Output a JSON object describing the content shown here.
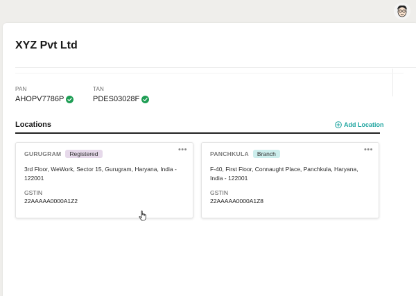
{
  "company": {
    "name": "XYZ Pvt Ltd",
    "pan_label": "PAN",
    "pan_value": "AHOPV7786P",
    "tan_label": "TAN",
    "tan_value": "PDES03028F"
  },
  "locations": {
    "title": "Locations",
    "add_label": "Add Location",
    "accent_color": "#1fa5a0",
    "cards": [
      {
        "city": "GURUGRAM",
        "badge": "Registered",
        "address": "3rd Floor, WeWork, Sector 15, Gurugram, Haryana, India - 122001",
        "gstin_label": "GSTIN",
        "gstin_value": "22AAAAA0000A1Z2"
      },
      {
        "city": "PANCHKULA",
        "badge": "Branch",
        "address": "F-40, First Floor, Connaught Place, Panchkula, Haryana, India - 122001",
        "gstin_label": "GSTIN",
        "gstin_value": "22AAAAA0000A1Z8"
      }
    ]
  },
  "icons": {
    "verified": "check-circle-icon",
    "add": "plus-circle-icon",
    "more": "more-horizontal-icon",
    "pointer": "hand-pointer-cursor"
  }
}
